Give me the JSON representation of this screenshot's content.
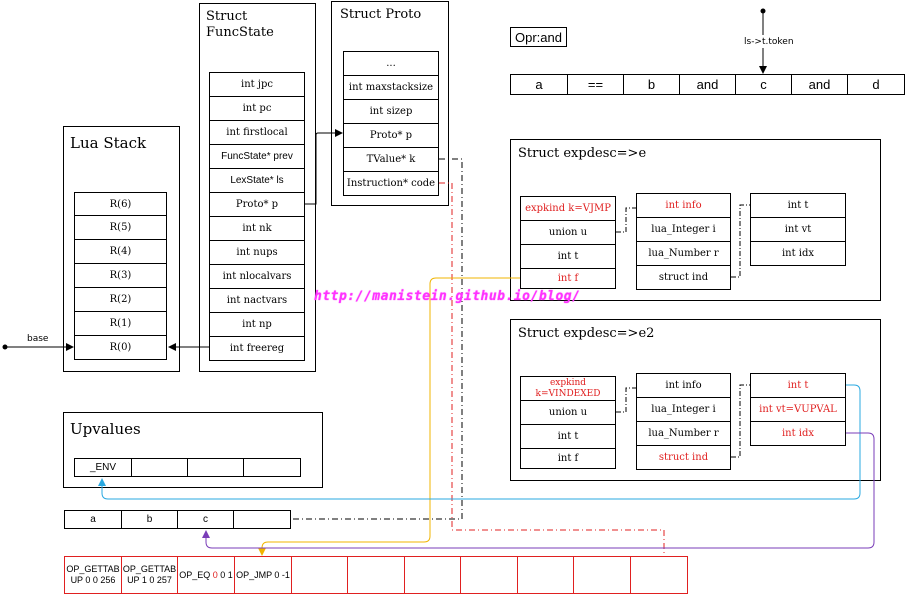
{
  "lua_stack": {
    "title": "Lua Stack",
    "registers": [
      "R(6)",
      "R(5)",
      "R(4)",
      "R(3)",
      "R(2)",
      "R(1)",
      "R(0)"
    ],
    "base_label": "base"
  },
  "funcstate": {
    "title": "Struct\nFuncState",
    "fields": [
      "int jpc",
      "int pc",
      "int firstlocal",
      "FuncState* prev",
      "LexState* ls",
      "Proto* p",
      "int nk",
      "int nups",
      "int nlocalvars",
      "int nactvars",
      "int np",
      "int freereg"
    ]
  },
  "proto": {
    "title": "Struct Proto",
    "fields": [
      "...",
      "int maxstacksize",
      "int sizep",
      "Proto* p",
      "TValue* k",
      "Instruction* code"
    ]
  },
  "opr": {
    "label": "Opr:and"
  },
  "token_label": "ls->t.token",
  "tokens": [
    "a",
    "==",
    "b",
    "and",
    "c",
    "and",
    "d"
  ],
  "expdesc_e": {
    "title": "Struct expdesc=>e",
    "col1": [
      "expkind k=VJMP",
      "union u",
      "int t",
      "int f"
    ],
    "col2": [
      "int info",
      "lua_Integer i",
      "lua_Number r",
      "struct ind"
    ],
    "col3": [
      "int t",
      "int vt",
      "int idx"
    ]
  },
  "expdesc_e2": {
    "title": "Struct expdesc=>e2",
    "col1": [
      "expkind k=VINDEXED",
      "union u",
      "int t",
      "int f"
    ],
    "col2": [
      "int info",
      "lua_Integer i",
      "lua_Number r",
      "struct ind"
    ],
    "col3": [
      "int t",
      "int vt=VUPVAL",
      "int idx"
    ]
  },
  "upvalues": {
    "title": "Upvalues",
    "cells": [
      "_ENV",
      "",
      "",
      ""
    ]
  },
  "locals": [
    "a",
    "b",
    "c",
    ""
  ],
  "code": {
    "instructions": [
      {
        "name": "OP_GETTAB UP 0 0 256"
      },
      {
        "name": "OP_GETTAB UP 1 0 257"
      },
      {
        "op": "OP_EQ",
        "a": "0",
        "b": "0",
        "c": "1"
      },
      {
        "name": "OP_JMP 0 -1"
      },
      {
        "name": ""
      },
      {
        "name": ""
      },
      {
        "name": ""
      },
      {
        "name": ""
      }
    ]
  },
  "watermark": "http://manistein.github.io/blog/",
  "colors": {
    "red": "#e02020",
    "yellow": "#f0b400",
    "cyan": "#29a8e0",
    "purple": "#7a3db8",
    "watermark": "#ff33ff"
  }
}
